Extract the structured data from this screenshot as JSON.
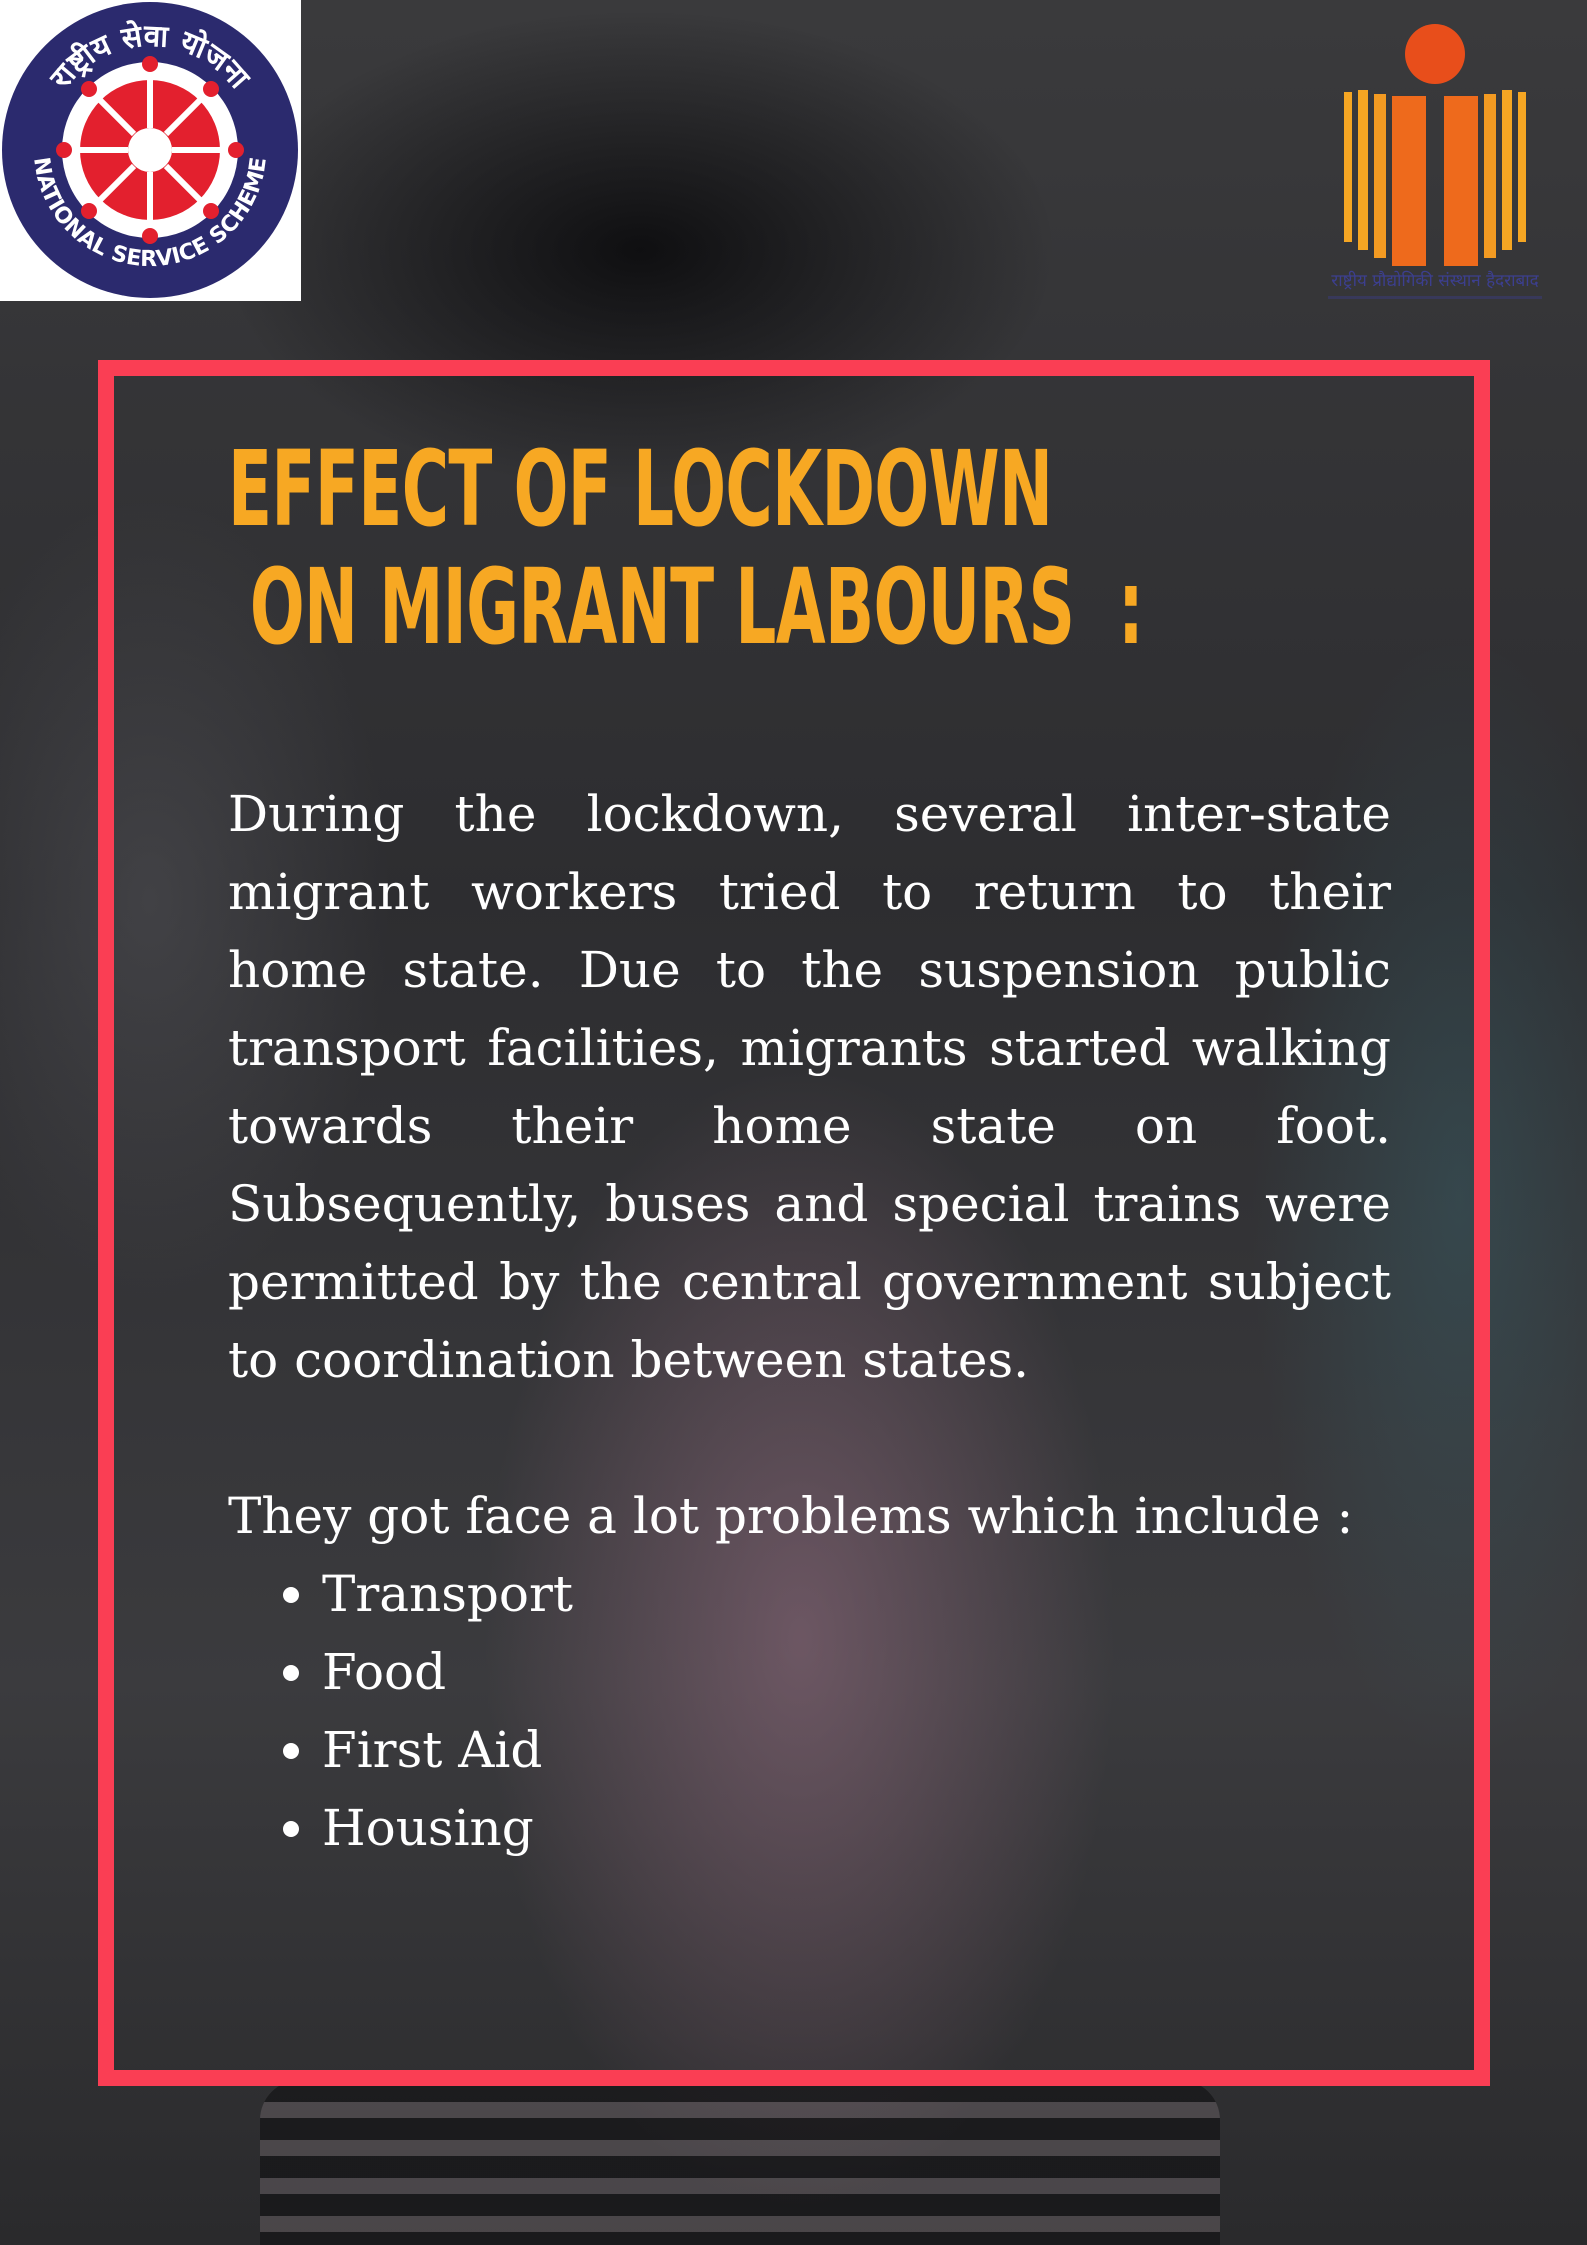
{
  "logos": {
    "nss": {
      "top_text": "राष्ट्रीय सेवा योजना",
      "bottom_text": "NATIONAL SERVICE SCHEME",
      "colors": {
        "ring": "#2b2a6e",
        "wheel": "#e3202e",
        "background": "#ffffff"
      }
    },
    "institute": {
      "caption": "राष्ट्रीय प्रौद्योगिकी संस्थान हैदराबाद",
      "colors": {
        "dot": "#e84e1b",
        "book_light": "#f5a623",
        "book_dark": "#ee6a1c",
        "caption": "#3c3f8f"
      }
    }
  },
  "frame": {
    "color": "#fa3e54"
  },
  "content": {
    "title": "EFFECT OF LOCKDOWN\n ON MIGRANT LABOURS  :",
    "paragraph": "During the lockdown, several inter-state migrant workers tried to return to their home state. Due to the suspension public transport facilities, migrants started walking towards their home state on foot. Subsequently, buses and special trains were permitted by the central government subject to coordination between states.",
    "intro": "They got face a lot problems which include :",
    "problems": [
      "Transport",
      "Food",
      "First Aid",
      "Housing"
    ]
  },
  "colors": {
    "title": "#f7a823",
    "text": "#ffffff"
  }
}
